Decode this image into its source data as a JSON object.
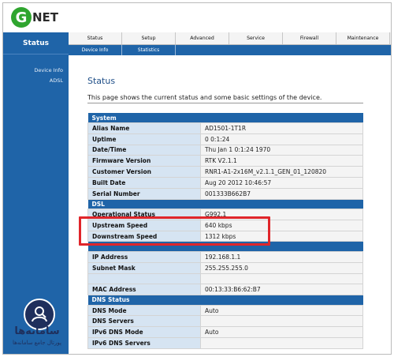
{
  "brand": {
    "logo_letter": "G",
    "logo_text": "NET",
    "logo_color": "#2fa52f"
  },
  "sidebar": {
    "title": "Status",
    "items": [
      {
        "label": "Device Info"
      },
      {
        "label": "ADSL"
      }
    ]
  },
  "nav": {
    "tabs": [
      {
        "label": "Status"
      },
      {
        "label": "Setup"
      },
      {
        "label": "Advanced"
      },
      {
        "label": "Service"
      },
      {
        "label": "Firewall"
      },
      {
        "label": "Maintenance"
      }
    ]
  },
  "subnav": {
    "tabs": [
      {
        "label": "Device Info"
      },
      {
        "label": "Statistics"
      }
    ]
  },
  "main": {
    "title": "Status",
    "description": "This page shows the current status and some basic settings of the device."
  },
  "system": {
    "header": "System",
    "rows": [
      {
        "label": "Alias Name",
        "value": "AD1501-1T1R"
      },
      {
        "label": "Uptime",
        "value": "0 0:1:24"
      },
      {
        "label": "Date/Time",
        "value": "Thu Jan 1 0:1:24 1970"
      },
      {
        "label": "Firmware Version",
        "value": "RTK V2.1.1"
      },
      {
        "label": "Customer Version",
        "value": "RNR1-A1-2x16M_v2.1.1_GEN_01_120820"
      },
      {
        "label": "Built Date",
        "value": "Aug 20 2012 10:46:57"
      },
      {
        "label": "Serial Number",
        "value": "001333B662B7"
      }
    ]
  },
  "dsl": {
    "header": "DSL",
    "rows": [
      {
        "label": "Operational Status",
        "value": "G992.1"
      },
      {
        "label": "Upstream Speed",
        "value": "640 kbps"
      },
      {
        "label": "Downstream Speed",
        "value": "1312 kbps"
      }
    ]
  },
  "lan": {
    "header": "",
    "rows": [
      {
        "label": "IP Address",
        "value": "192.168.1.1"
      },
      {
        "label": "Subnet Mask",
        "value": "255.255.255.0"
      },
      {
        "label": "",
        "value": ""
      },
      {
        "label": "MAC Address",
        "value": "00:13:33:B6:62:B7"
      }
    ]
  },
  "dns": {
    "header": "DNS Status",
    "rows": [
      {
        "label": "DNS Mode",
        "value": "Auto"
      },
      {
        "label": "DNS Servers",
        "value": ""
      },
      {
        "label": "IPv6 DNS Mode",
        "value": "Auto"
      },
      {
        "label": "IPv6 DNS Servers",
        "value": ""
      }
    ]
  },
  "watermark": {
    "title": "سامانه‌ها",
    "subtitle": "پورتال جامع سامانه‌ها"
  },
  "colors": {
    "accent": "#1f64a8",
    "highlight": "#e0252a"
  }
}
